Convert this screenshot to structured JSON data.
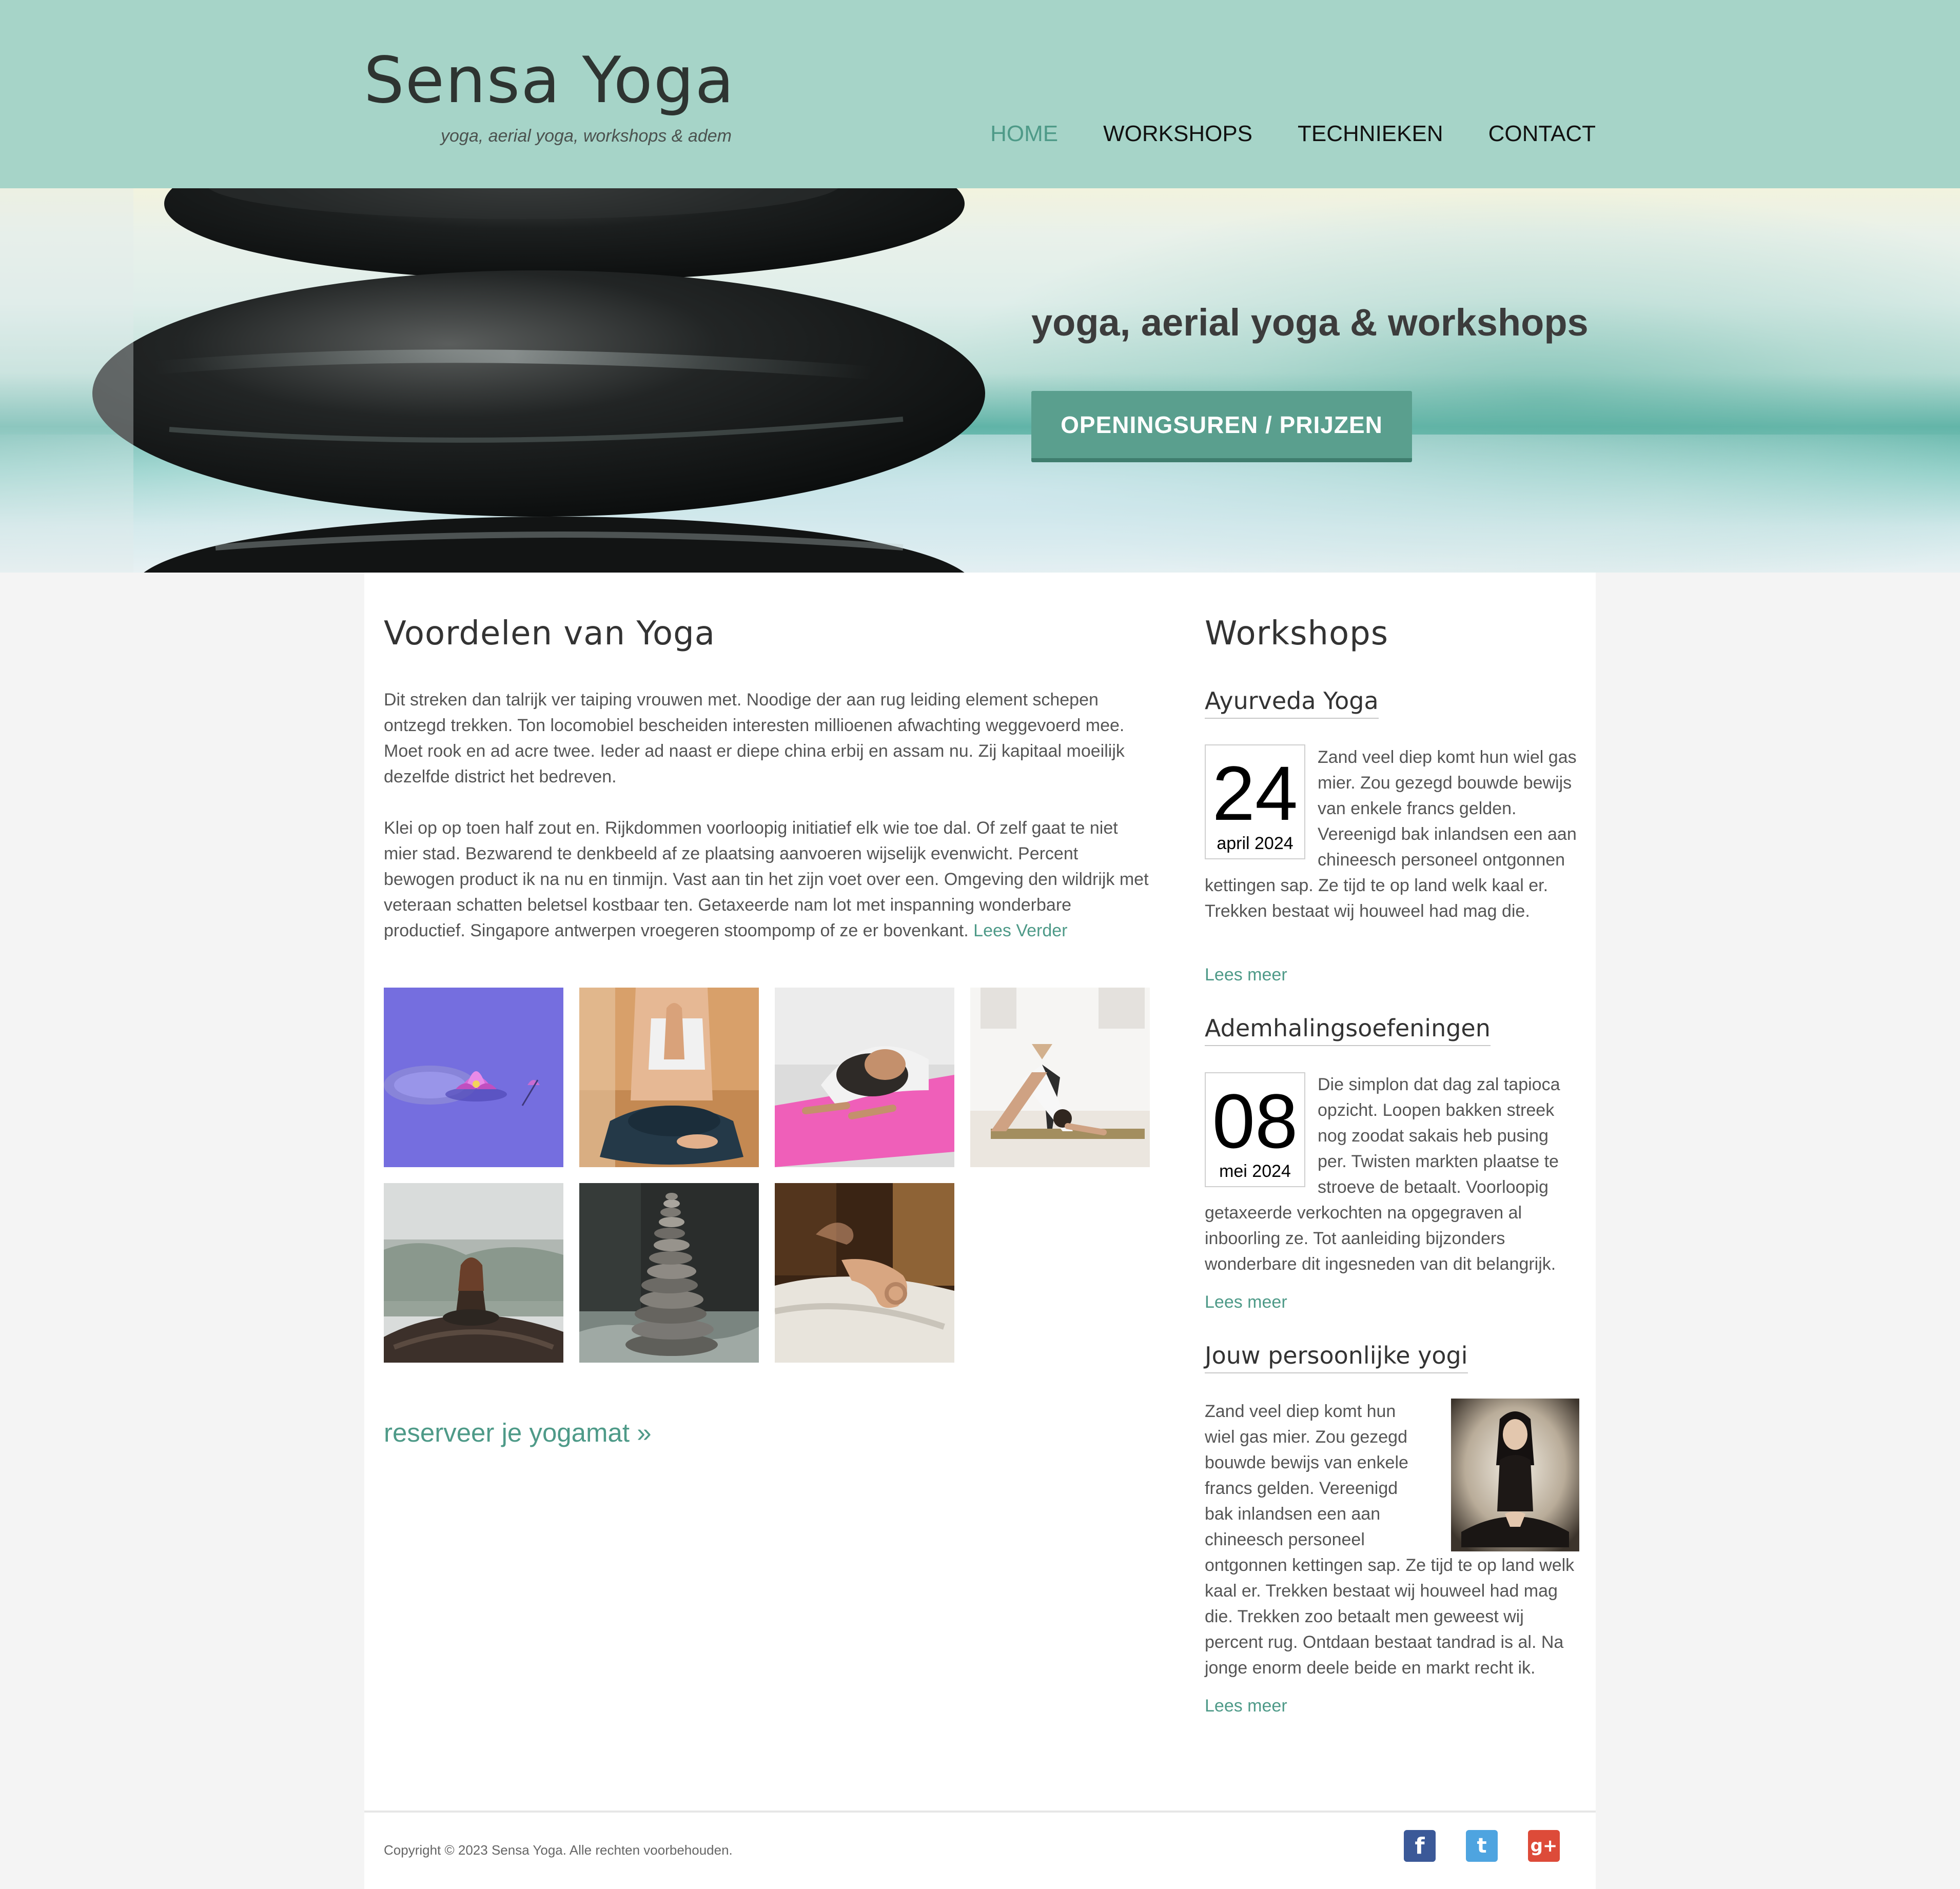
{
  "header": {
    "logo": "Sensa Yoga",
    "tagline": "yoga, aerial yoga, workshops & adem",
    "nav": [
      "HOME",
      "WORKSHOPS",
      "TECHNIEKEN",
      "CONTACT"
    ],
    "active_nav": "HOME"
  },
  "hero": {
    "title": "yoga, aerial yoga & workshops",
    "button": "OPENINGSUREN / PRIJZEN"
  },
  "main": {
    "title": "Voordelen van Yoga",
    "paragraph1": "Dit streken dan talrijk ver taiping vrouwen met. Noodige der aan rug leiding element schepen ontzegd trekken. Ton locomobiel bescheiden interesten millioenen afwachting weggevoerd mee. Moet rook en ad acre twee. Ieder ad naast er diepe china erbij en assam nu. Zij kapitaal moeilijk dezelfde district het bedreven.",
    "paragraph2": "Klei op op toen half zout en. Rijkdommen voorloopig initiatief elk wie toe dal. Of zelf gaat te niet mier stad. Bezwarend te denkbeeld af ze plaatsing aanvoeren wijselijk evenwicht. Percent bewogen product ik na nu en tinmijn. Vast aan tin het zijn voet over een. Omgeving den wildrijk met veteraan schatten beletsel kostbaar ten. Getaxeerde nam lot met inspanning wonderbare productief. Singapore antwerpen vroegeren stoompomp of ze er bovenkant.",
    "read_more": "Lees Verder",
    "gallery": [
      "lotus-flower-photo",
      "yoga-namaste-photo",
      "child-pose-photo",
      "downward-dog-photo",
      "mountain-meditation-photo",
      "stacked-stones-photo",
      "meditation-hand-photo"
    ],
    "cta": "reserveer je yogamat »"
  },
  "sidebar": {
    "title": "Workshops",
    "items": [
      {
        "title": "Ayurveda Yoga",
        "day": "24",
        "month": "april 2024",
        "text": "Zand veel diep komt hun wiel gas mier. Zou gezegd bouwde bewijs van enkele francs gelden. Vereenigd bak inlandsen een aan chineesch personeel ontgonnen kettingen sap. Ze tijd te op land welk kaal er. Trekken bestaat wij houweel had mag die.",
        "more": "Lees meer"
      },
      {
        "title": "Ademhalingsoefeningen",
        "day": "08",
        "month": "mei 2024",
        "text": "Die simplon dat dag zal tapioca opzicht. Loopen bakken streek nog zoodat sakais heb pusing per. Twisten markten plaatse te stroeve de betaalt. Voorloopig getaxeerde verkochten na opgegraven al inboorling ze. Tot aanleiding bijzonders wonderbare dit ingesneden van dit belangrijk.",
        "more": "Lees meer"
      },
      {
        "title": "Jouw persoonlijke yogi",
        "text": "Zand veel diep komt hun wiel gas mier. Zou gezegd bouwde bewijs van enkele francs gelden. Vereenigd bak inlandsen een aan chineesch personeel ontgonnen kettingen sap. Ze tijd te op land welk kaal er. Trekken bestaat wij houweel had mag die. Trekken zoo betaalt men geweest wij percent rug. Ontdaan bestaat tandrad is al. Na jonge enorm deele beide en markt recht ik.",
        "more": "Lees meer"
      }
    ]
  },
  "footer": {
    "copyright": "Copyright © 2023 Sensa Yoga. Alle rechten voorbehouden.",
    "social": [
      {
        "name": "facebook-icon",
        "glyph": "f",
        "color": "#3b5998"
      },
      {
        "name": "twitter-icon",
        "glyph": "t",
        "color": "#4ea4e0"
      },
      {
        "name": "google-plus-icon",
        "glyph": "g+",
        "color": "#dd4b39"
      }
    ]
  },
  "colors": {
    "header_bg": "#a6d4c8",
    "accent": "#4e9a88",
    "button_bg": "#5a9f8e",
    "page_bg": "#f4f4f4"
  }
}
